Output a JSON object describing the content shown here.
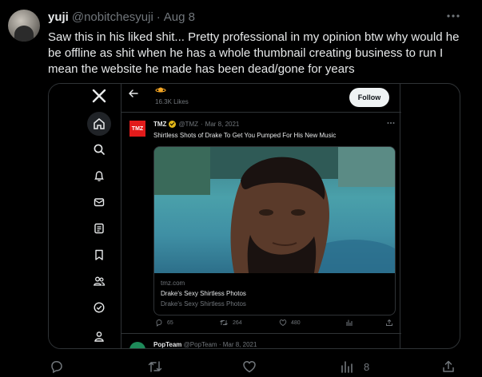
{
  "tweet": {
    "display_name": "yuji",
    "handle": "@nobitchesyuji",
    "separator": "·",
    "date": "Aug 8",
    "text": "Saw this in his liked shit... Pretty professional in my opinion btw why would he be offline as shit when he has a whole thumbnail creating business to run I mean the website he made has been dead/gone for years",
    "more_icon": "more-horizontal-icon"
  },
  "screenshot": {
    "sidebar": {
      "logo": "x-logo-icon",
      "items": [
        "home-icon",
        "search-icon",
        "bell-icon",
        "mail-icon",
        "list-icon",
        "bookmark-icon",
        "people-icon",
        "verified-icon",
        "profile-icon"
      ]
    },
    "topbar": {
      "back_icon": "back-arrow-icon",
      "likes": "16.3K Likes",
      "follow_label": "Follow"
    },
    "post": {
      "logo_text": "TMZ",
      "name": "TMZ",
      "handle": "@TMZ",
      "separator": "·",
      "date": "Mar 8, 2021",
      "text": "Shirtless Shots of Drake To Get You Pumped For His New Music",
      "card": {
        "domain": "tmz.com",
        "title": "Drake's Sexy Shirtless Photos",
        "description": "Drake's Sexy Shirtless Photos"
      },
      "actions": {
        "replies": "65",
        "reposts": "264",
        "likes": "480"
      }
    },
    "next_post": {
      "name": "PopTeam",
      "handle": "@PopTeam",
      "separator": "·",
      "date": "Mar 8, 2021"
    }
  },
  "actions": {
    "views": "8"
  }
}
